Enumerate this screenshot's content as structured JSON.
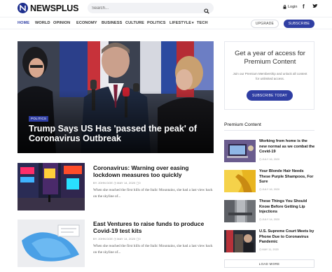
{
  "header": {
    "logo_text": "NEWSPLUS",
    "search_placeholder": "Search...",
    "login_label": "Login",
    "facebook_glyph": "f",
    "twitter_glyph": "t"
  },
  "nav": {
    "items": [
      "HOME",
      "WORLD",
      "OPINION",
      "ECONOMY",
      "BUSINESS",
      "CULTURE",
      "POLITICS",
      "LIFESTYLE",
      "TECH"
    ],
    "active": "HOME",
    "upgrade_label": "UPGRADE",
    "subscribe_label": "SUBSCRIBE"
  },
  "hero": {
    "tag": "POLITICS",
    "title": "Trump Says US Has 'passed the peak' of Coronavirus Outbreak"
  },
  "articles": [
    {
      "title": "Coronavirus: Warning over easing lockdown measures too quickly",
      "meta": "BY JOHN DOE   ◷ MAY 14, 2020   ▢0",
      "excerpt": "When she reached the first hills of the Italic Mountains, she had a last view back on the skyline of..."
    },
    {
      "title": "East Ventures to raise funds to produce Covid-19 test kits",
      "meta": "BY JOHN DOE   ◷ MAY 14, 2020   ▢0",
      "excerpt": "When she reached the first hills of the Italic Mountains, she had a last view back on the skyline of..."
    }
  ],
  "premium_box": {
    "heading": "Get a year of access for Premium Content",
    "description": "Join our Premium Membership and unlock all content for unlimited access.",
    "button_label": "SUBSCRIBE TODAY"
  },
  "premium_list": {
    "heading": "Premium Content",
    "items": [
      {
        "title": "Working from home is the new normal as we combat the Covid-19",
        "date": "◷ JULY 16, 2020"
      },
      {
        "title": "Your Blonde Hair Needs These Purple Shampoos, For Sure",
        "date": "◷ JULY 16, 2020"
      },
      {
        "title": "These Things You Should Know Before Getting Lip Injections",
        "date": "◷ JULY 14, 2020"
      },
      {
        "title": "U.S. Supreme Court Meets by Phone Due to Coronavirus Pandemic",
        "date": "◷ MAY 11, 2020"
      }
    ],
    "load_more_label": "LOAD MORE"
  },
  "colors": {
    "accent": "#2f3ea3",
    "logo": "#1e2f8e"
  }
}
